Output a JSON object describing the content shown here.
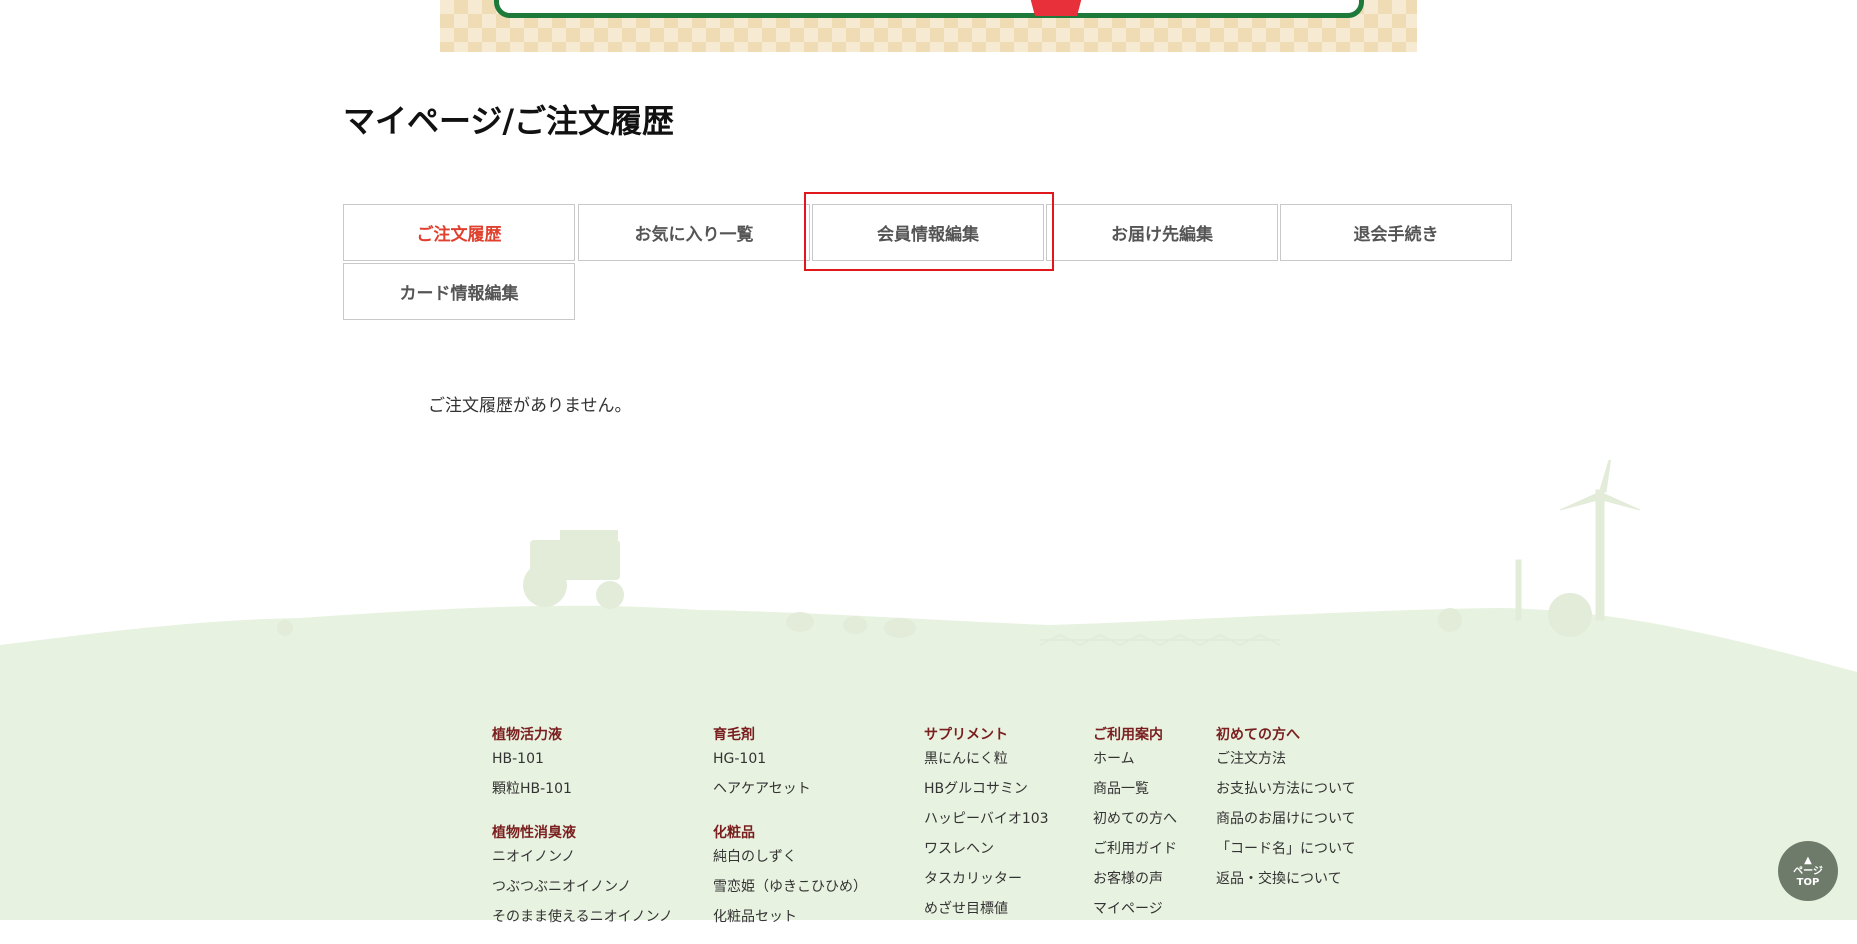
{
  "page": {
    "title": "マイページ/ご注文履歴",
    "empty_message": "ご注文履歴がありません。"
  },
  "tabs": [
    {
      "label": "ご注文履歴",
      "active": true
    },
    {
      "label": "お気に入り一覧",
      "active": false
    },
    {
      "label": "会員情報編集",
      "active": false
    },
    {
      "label": "お届け先編集",
      "active": false
    },
    {
      "label": "退会手続き",
      "active": false
    },
    {
      "label": "カード情報編集",
      "active": false
    }
  ],
  "footer": {
    "col1": {
      "groups": [
        {
          "heading": "植物活力液",
          "links": [
            "HB-101",
            "顆粒HB-101"
          ]
        },
        {
          "heading": "植物性消臭液",
          "links": [
            "ニオイノンノ",
            "つぶつぶニオイノンノ",
            "そのまま使えるニオイノンノ"
          ]
        }
      ]
    },
    "col2": {
      "groups": [
        {
          "heading": "育毛剤",
          "links": [
            "HG-101",
            "ヘアケアセット"
          ]
        },
        {
          "heading": "化粧品",
          "links": [
            "純白のしずく",
            "雪恋姫（ゆきこひひめ）",
            "化粧品セット"
          ]
        }
      ]
    },
    "col3": {
      "groups": [
        {
          "heading": "サプリメント",
          "links": [
            "黒にんにく粒",
            "HBグルコサミン",
            "ハッピーバイオ103",
            "ワスレヘン",
            "タスカリッター",
            "めざせ目標値"
          ]
        }
      ]
    },
    "col4": {
      "groups": [
        {
          "heading": "ご利用案内",
          "links": [
            "ホーム",
            "商品一覧",
            "初めての方へ",
            "ご利用ガイド",
            "お客様の声",
            "マイページ"
          ]
        }
      ]
    },
    "col5": {
      "groups": [
        {
          "heading": "初めての方へ",
          "links": [
            "ご注文方法",
            "お支払い方法について",
            "商品のお届けについて",
            "「コード名」について",
            "返品・交換について"
          ]
        }
      ]
    },
    "page_top": {
      "arrow": "▲",
      "line1": "ページ",
      "line2": "TOP"
    }
  },
  "colors": {
    "active_tab": "#e0412f",
    "highlight": "#e0181b",
    "footer_bg": "#e8f2e0",
    "footer_heading": "#7a1f1f"
  }
}
